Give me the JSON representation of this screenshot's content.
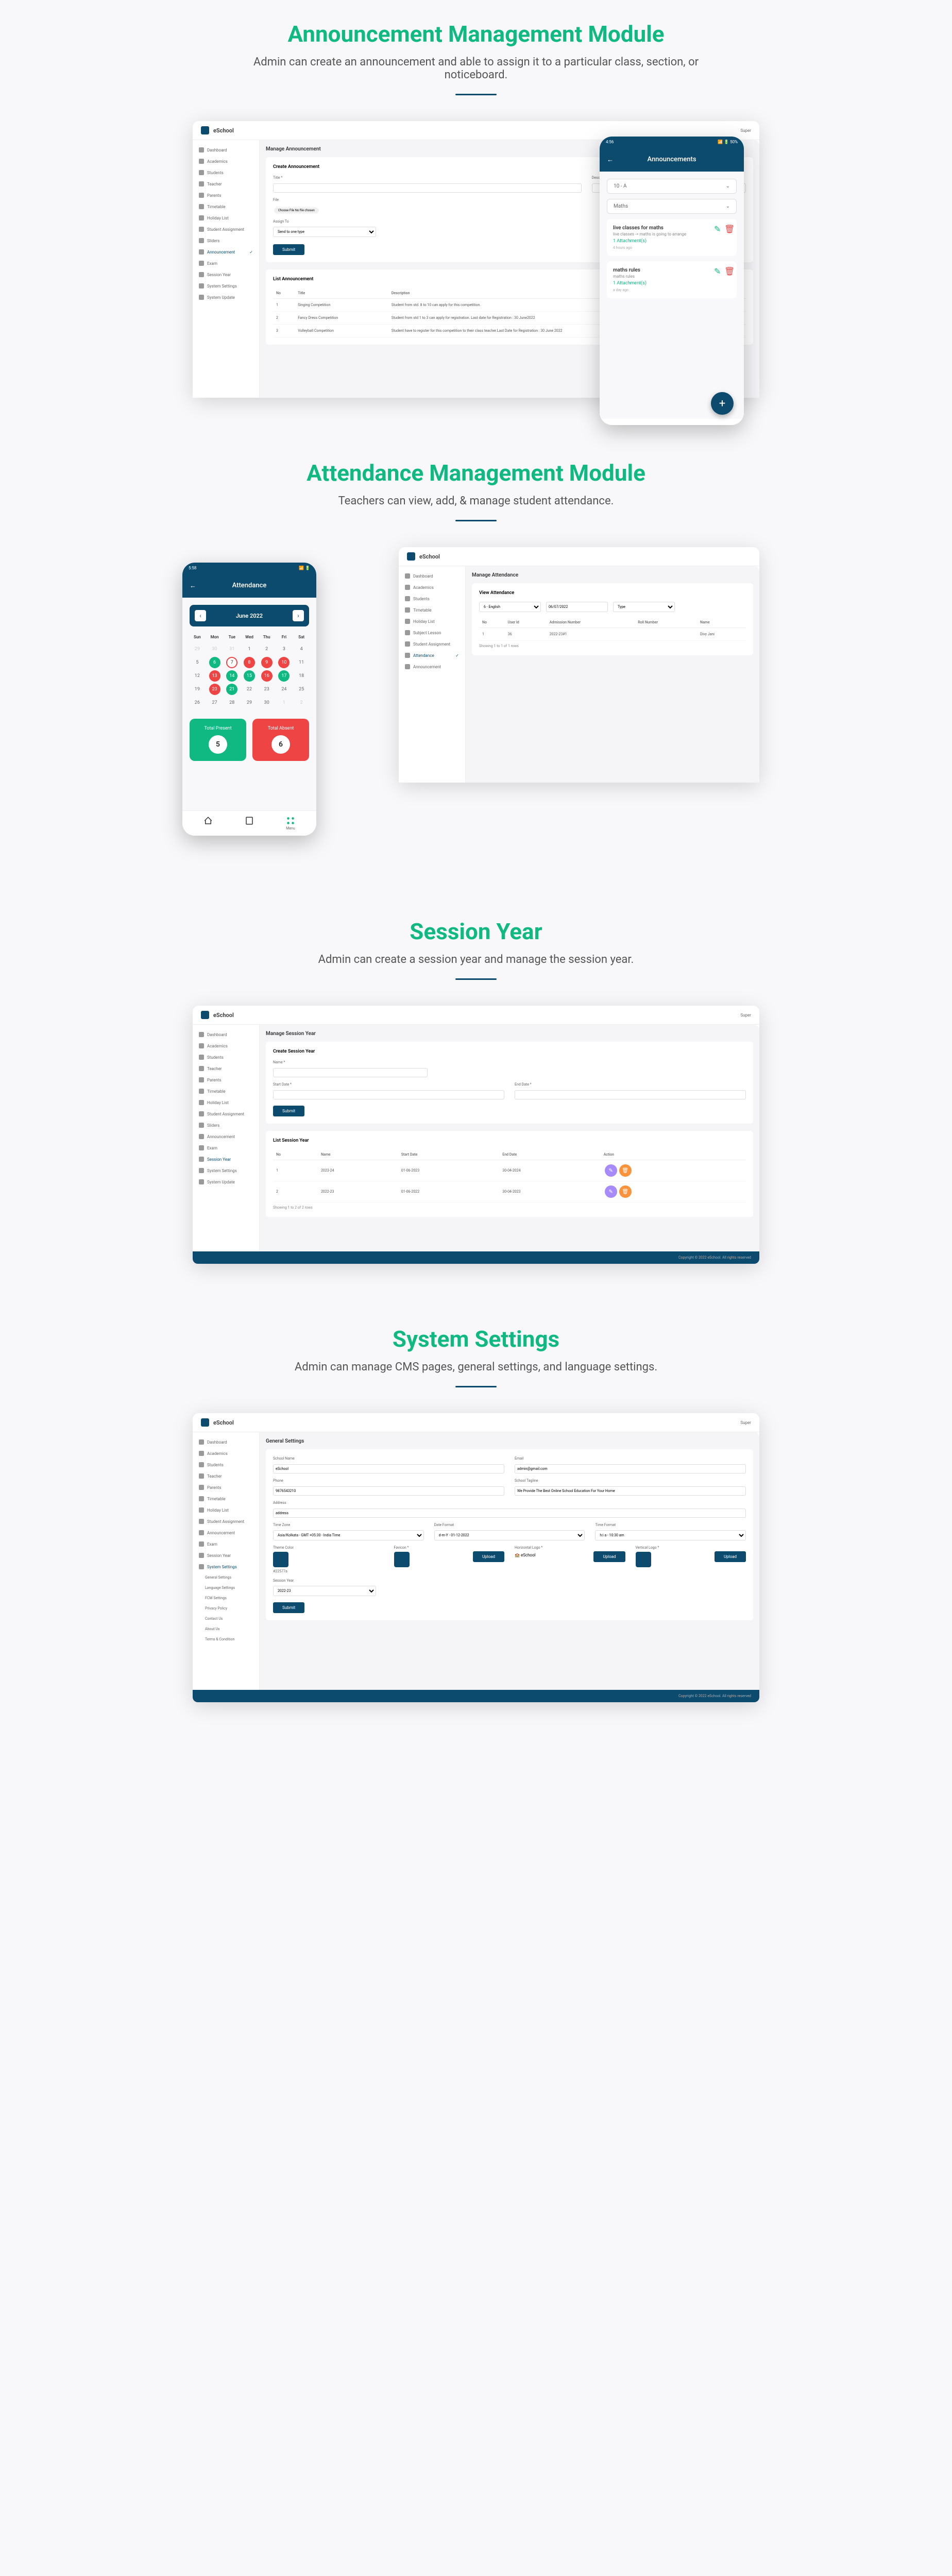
{
  "sections": {
    "ann": {
      "title": "Announcement Management Module",
      "desc": "Admin can create an announcement and able to assign it to a particular class, section, or noticeboard."
    },
    "att": {
      "title": "Attendance Management Module",
      "desc": "Teachers can view, add, & manage student attendance."
    },
    "sess": {
      "title": "Session Year",
      "desc": "Admin can create a session year and manage the session year."
    },
    "sys": {
      "title": "System Settings",
      "desc": "Admin can manage CMS pages, general settings, and language settings."
    }
  },
  "brand": "eSchool",
  "superAdmin": "Super",
  "sidebar": {
    "items": [
      "Dashboard",
      "Academics",
      "Students",
      "Teacher",
      "Parents",
      "Timetable",
      "Holiday List",
      "Student Assignment",
      "Sliders",
      "Announcement",
      "Exam",
      "Session Year",
      "System Settings",
      "System Update"
    ]
  },
  "announcement": {
    "pageTitle": "Manage Announcement",
    "createTitle": "Create Announcement",
    "labels": {
      "title": "Title *",
      "desc": "Description",
      "file": "File",
      "assign": "Assign To",
      "submit": "Submit"
    },
    "fileChip": "Choose File No file chosen",
    "assignValue": "Send to one type",
    "listTitle": "List Announcement",
    "cols": {
      "no": "No",
      "title": "Title",
      "desc": "Description"
    },
    "rows": [
      {
        "no": "1",
        "title": "Singing Competition",
        "desc": "Student from std. 8 to 10 can apply for this competition."
      },
      {
        "no": "2",
        "title": "Fancy Dress Competition",
        "desc": "Student from std 1 to 3 can apply for registration. Last date for Registration : 30 June2022"
      },
      {
        "no": "3",
        "title": "Volleyball Competition",
        "desc": "Student have to register for this competition to their class teacher.Last Date for Registration : 30 June 2022"
      }
    ]
  },
  "phoneAnn": {
    "time": "4:56",
    "header": "Announcements",
    "dd1": "10 - A",
    "dd2": "Maths",
    "cards": [
      {
        "title": "live classes for maths",
        "sub": "live classes -> maths is going to arrange",
        "att": "1 Attachment(s)",
        "time": "4 hours ago"
      },
      {
        "title": "maths rules",
        "sub": "maths rules",
        "att": "1 Attachment(s)",
        "time": "a day ago"
      }
    ]
  },
  "attendance": {
    "pageTitle": "Manage Attendance",
    "viewTitle": "View Attendance",
    "classSel": "6 - English",
    "dateSel": "06/07/2022",
    "typeSel": "Type",
    "cols": {
      "no": "No",
      "uid": "User Id",
      "adm": "Admission Number",
      "roll": "Roll Number",
      "name": "Name"
    },
    "row": {
      "no": "1",
      "uid": "36",
      "adm": "2022-23#1",
      "roll": "",
      "name": "Divy Jani"
    },
    "showing": "Showing 1 to 1 of 1 rows",
    "sidebarItems": [
      "Dashboard",
      "Academics",
      "Students",
      "Timetable",
      "Holiday List",
      "Subject Lesson",
      "Student Assignment",
      "Attendance",
      "Announcement"
    ]
  },
  "phoneAtt": {
    "header": "Attendance",
    "month": "June 2022",
    "dow": [
      "Sun",
      "Mon",
      "Tue",
      "Wed",
      "Thu",
      "Fri",
      "Sat"
    ],
    "present": {
      "label": "Total Present",
      "val": "5"
    },
    "absent": {
      "label": "Total Absent",
      "val": "6"
    },
    "nav": [
      "Home",
      "Assign.",
      "Menu"
    ]
  },
  "session": {
    "pageTitle": "Manage Session Year",
    "createTitle": "Create Session Year",
    "labels": {
      "name": "Name *",
      "start": "Start Date *",
      "end": "End Date *",
      "submit": "Submit"
    },
    "listTitle": "List Session Year",
    "cols": {
      "no": "No",
      "name": "Name",
      "start": "Start Date",
      "end": "End Date",
      "action": "Action"
    },
    "rows": [
      {
        "no": "1",
        "name": "2023-24",
        "start": "01-06-2023",
        "end": "30-04-2024"
      },
      {
        "no": "2",
        "name": "2022-23",
        "start": "01-06-2022",
        "end": "30-04-2023"
      }
    ],
    "showing": "Showing 1 to 2 of 2 rows"
  },
  "settings": {
    "pageTitle": "General Settings",
    "labels": {
      "schoolName": "School Name",
      "email": "Email",
      "phone": "Phone",
      "tagline": "School Tagline",
      "address": "Address",
      "tz": "Time Zone",
      "dateFmt": "Date Format",
      "timeFmt": "Time Format",
      "theme": "Theme Color",
      "favicon": "Favicon *",
      "hlogo": "Horizontal Logo *",
      "vlogo": "Vertical Logo *",
      "sessYear": "Session Year",
      "upload": "Upload",
      "submit": "Submit"
    },
    "vals": {
      "schoolName": "eSchool",
      "email": "admin@gmail.com",
      "phone": "9876543210",
      "tagline": "We Provide The Best Online School Education For Your Home",
      "address": "address",
      "tz": "Asia/Kolkata - GMT +05:30 - India Time",
      "dateFmt": "d-m-Y - 01-12-2022",
      "timeFmt": "h:i a - 10:30 am",
      "theme": "#22577a",
      "sessYear": "2022-23"
    },
    "sidebarExtra": [
      "General Settings",
      "Language Settings",
      "FCM Settings",
      "Privacy Policy",
      "Contact Us",
      "About Us",
      "Terms & Condition"
    ],
    "footer": "Copyright © 2022 eSchool. All rights reserved"
  }
}
